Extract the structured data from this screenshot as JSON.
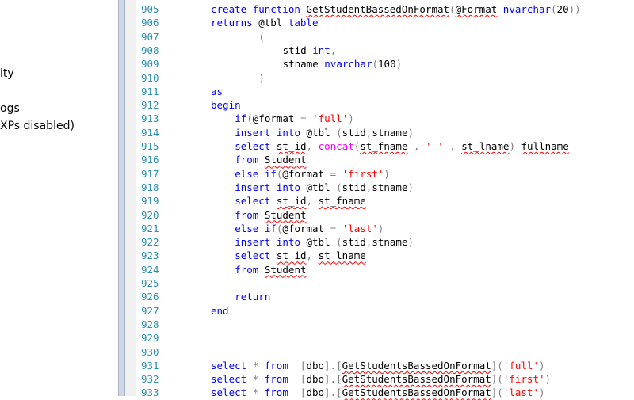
{
  "object_explorer": {
    "items": [
      "ity",
      "ogs",
      "XPs disabled)"
    ]
  },
  "editor": {
    "lines": [
      {
        "n": "905",
        "indent": 0,
        "t": [
          [
            "kw",
            "create function"
          ],
          [
            "p",
            " "
          ],
          [
            "sq",
            "GetStudentBassedOnFormat"
          ],
          [
            "gray",
            "("
          ],
          [
            "sq",
            "@Format"
          ],
          [
            "p",
            " "
          ],
          [
            "kw",
            "nvarchar"
          ],
          [
            "gray",
            "("
          ],
          [
            "p",
            "20"
          ],
          [
            "gray",
            "))"
          ]
        ]
      },
      {
        "n": "906",
        "indent": 0,
        "t": [
          [
            "kw",
            "returns"
          ],
          [
            "p",
            " @tbl "
          ],
          [
            "kw",
            "table"
          ]
        ]
      },
      {
        "n": "907",
        "indent": 8,
        "t": [
          [
            "gray",
            "("
          ]
        ]
      },
      {
        "n": "908",
        "indent": 12,
        "t": [
          [
            "p",
            "stid "
          ],
          [
            "kw",
            "int"
          ],
          [
            "gray",
            ","
          ]
        ]
      },
      {
        "n": "909",
        "indent": 12,
        "t": [
          [
            "p",
            "stname "
          ],
          [
            "kw",
            "nvarchar"
          ],
          [
            "gray",
            "("
          ],
          [
            "p",
            "100"
          ],
          [
            "gray",
            ")"
          ]
        ]
      },
      {
        "n": "910",
        "indent": 8,
        "t": [
          [
            "gray",
            ")"
          ]
        ]
      },
      {
        "n": "911",
        "indent": 0,
        "t": [
          [
            "kw",
            "as"
          ]
        ]
      },
      {
        "n": "912",
        "indent": 0,
        "t": [
          [
            "kw",
            "begin"
          ]
        ]
      },
      {
        "n": "913",
        "indent": 4,
        "t": [
          [
            "kw",
            "if"
          ],
          [
            "gray",
            "("
          ],
          [
            "p",
            "@format "
          ],
          [
            "gray",
            "="
          ],
          [
            "p",
            " "
          ],
          [
            "str",
            "'full'"
          ],
          [
            "gray",
            ")"
          ]
        ]
      },
      {
        "n": "914",
        "indent": 4,
        "t": [
          [
            "kw",
            "insert into"
          ],
          [
            "p",
            " @tbl "
          ],
          [
            "gray",
            "("
          ],
          [
            "p",
            "stid"
          ],
          [
            "gray",
            ","
          ],
          [
            "p",
            "stname"
          ],
          [
            "gray",
            ")"
          ]
        ]
      },
      {
        "n": "915",
        "indent": 4,
        "t": [
          [
            "kw",
            "select"
          ],
          [
            "p",
            " "
          ],
          [
            "sq",
            "st_id"
          ],
          [
            "gray",
            ","
          ],
          [
            "p",
            " "
          ],
          [
            "fn",
            "concat"
          ],
          [
            "gray",
            "("
          ],
          [
            "sq",
            "st_fname"
          ],
          [
            "p",
            " "
          ],
          [
            "gray",
            ","
          ],
          [
            "p",
            " "
          ],
          [
            "str",
            "' '"
          ],
          [
            "p",
            " "
          ],
          [
            "gray",
            ","
          ],
          [
            "p",
            " "
          ],
          [
            "sq",
            "st_lname"
          ],
          [
            "gray",
            ")"
          ],
          [
            "p",
            " "
          ],
          [
            "sq",
            "fullname"
          ]
        ]
      },
      {
        "n": "916",
        "indent": 4,
        "t": [
          [
            "kw",
            "from"
          ],
          [
            "p",
            " "
          ],
          [
            "sq",
            "Student"
          ]
        ]
      },
      {
        "n": "917",
        "indent": 4,
        "t": [
          [
            "kw",
            "else if"
          ],
          [
            "gray",
            "("
          ],
          [
            "p",
            "@format "
          ],
          [
            "gray",
            "="
          ],
          [
            "p",
            " "
          ],
          [
            "str",
            "'first'"
          ],
          [
            "gray",
            ")"
          ]
        ]
      },
      {
        "n": "918",
        "indent": 4,
        "t": [
          [
            "kw",
            "insert into"
          ],
          [
            "p",
            " @tbl "
          ],
          [
            "gray",
            "("
          ],
          [
            "p",
            "stid"
          ],
          [
            "gray",
            ","
          ],
          [
            "p",
            "stname"
          ],
          [
            "gray",
            ")"
          ]
        ]
      },
      {
        "n": "919",
        "indent": 4,
        "t": [
          [
            "kw",
            "select"
          ],
          [
            "p",
            " "
          ],
          [
            "sq",
            "st_id"
          ],
          [
            "gray",
            ","
          ],
          [
            "p",
            " "
          ],
          [
            "sq",
            "st_fname"
          ]
        ]
      },
      {
        "n": "920",
        "indent": 4,
        "t": [
          [
            "kw",
            "from"
          ],
          [
            "p",
            " "
          ],
          [
            "sq",
            "Student"
          ]
        ]
      },
      {
        "n": "921",
        "indent": 4,
        "t": [
          [
            "kw",
            "else if"
          ],
          [
            "gray",
            "("
          ],
          [
            "p",
            "@format "
          ],
          [
            "gray",
            "="
          ],
          [
            "p",
            " "
          ],
          [
            "str",
            "'last'"
          ],
          [
            "gray",
            ")"
          ]
        ]
      },
      {
        "n": "922",
        "indent": 4,
        "t": [
          [
            "kw",
            "insert into"
          ],
          [
            "p",
            " @tbl "
          ],
          [
            "gray",
            "("
          ],
          [
            "p",
            "stid"
          ],
          [
            "gray",
            ","
          ],
          [
            "p",
            "stname"
          ],
          [
            "gray",
            ")"
          ]
        ]
      },
      {
        "n": "923",
        "indent": 4,
        "t": [
          [
            "kw",
            "select"
          ],
          [
            "p",
            " "
          ],
          [
            "sq",
            "st_id"
          ],
          [
            "gray",
            ","
          ],
          [
            "p",
            " "
          ],
          [
            "sq",
            "st_lname"
          ]
        ]
      },
      {
        "n": "924",
        "indent": 4,
        "t": [
          [
            "kw",
            "from"
          ],
          [
            "p",
            " "
          ],
          [
            "sq",
            "Student"
          ]
        ]
      },
      {
        "n": "925",
        "indent": 0,
        "t": []
      },
      {
        "n": "926",
        "indent": 4,
        "t": [
          [
            "kw",
            "return"
          ]
        ]
      },
      {
        "n": "927",
        "indent": 0,
        "t": [
          [
            "kw",
            "end"
          ]
        ]
      },
      {
        "n": "928",
        "indent": 0,
        "t": []
      },
      {
        "n": "929",
        "indent": 0,
        "t": []
      },
      {
        "n": "930",
        "indent": 0,
        "t": []
      },
      {
        "n": "931",
        "indent": 0,
        "t": [
          [
            "kw",
            "select"
          ],
          [
            "p",
            " "
          ],
          [
            "gray",
            "*"
          ],
          [
            "p",
            " "
          ],
          [
            "kw",
            "from"
          ],
          [
            "p",
            "  "
          ],
          [
            "gray",
            "["
          ],
          [
            "p",
            "dbo"
          ],
          [
            "gray",
            "].["
          ],
          [
            "sq",
            "GetStudentsBassedOnFormat"
          ],
          [
            "gray",
            "]("
          ],
          [
            "str",
            "'full'"
          ],
          [
            "gray",
            ")"
          ]
        ]
      },
      {
        "n": "932",
        "indent": 0,
        "t": [
          [
            "kw",
            "select"
          ],
          [
            "p",
            " "
          ],
          [
            "gray",
            "*"
          ],
          [
            "p",
            " "
          ],
          [
            "kw",
            "from"
          ],
          [
            "p",
            "  "
          ],
          [
            "gray",
            "["
          ],
          [
            "p",
            "dbo"
          ],
          [
            "gray",
            "].["
          ],
          [
            "sq",
            "GetStudentsBassedOnFormat"
          ],
          [
            "gray",
            "]("
          ],
          [
            "str",
            "'first'"
          ],
          [
            "gray",
            ")"
          ]
        ]
      },
      {
        "n": "933",
        "indent": 0,
        "t": [
          [
            "kw",
            "select"
          ],
          [
            "p",
            " "
          ],
          [
            "gray",
            "*"
          ],
          [
            "p",
            " "
          ],
          [
            "kw",
            "from"
          ],
          [
            "p",
            "  "
          ],
          [
            "gray",
            "["
          ],
          [
            "p",
            "dbo"
          ],
          [
            "gray",
            "].["
          ],
          [
            "sq",
            "GetStudentsBassedOnFormat"
          ],
          [
            "gray",
            "]("
          ],
          [
            "str",
            "'last'"
          ],
          [
            "gray",
            ")"
          ]
        ]
      }
    ]
  }
}
